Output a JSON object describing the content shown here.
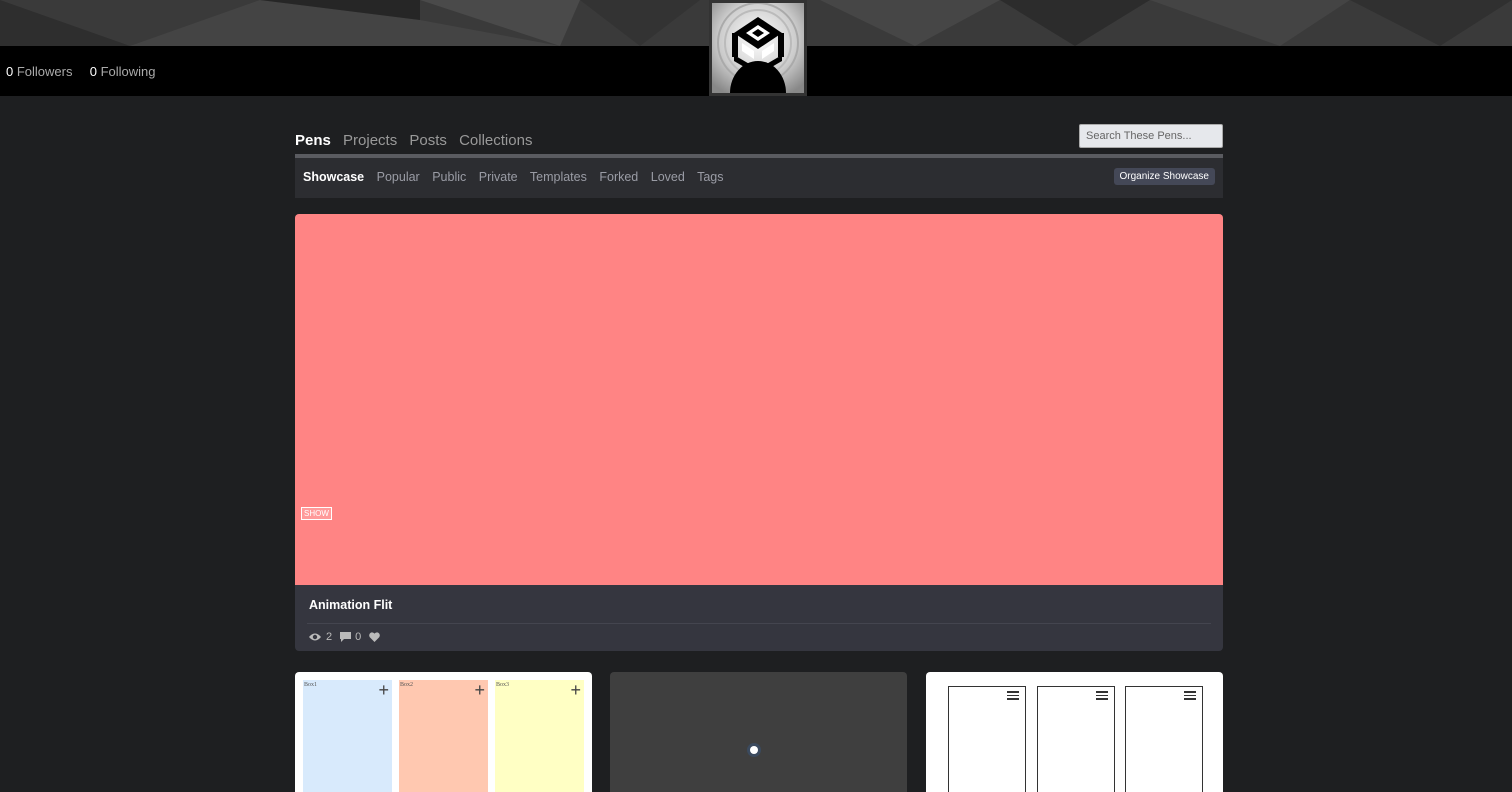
{
  "profile": {
    "followers_count": "0",
    "followers_label": "Followers",
    "following_count": "0",
    "following_label": "Following"
  },
  "tabs": {
    "main": [
      "Pens",
      "Projects",
      "Posts",
      "Collections"
    ],
    "active_main": "Pens",
    "sub": [
      "Showcase",
      "Popular",
      "Public",
      "Private",
      "Templates",
      "Forked",
      "Loved",
      "Tags"
    ],
    "active_sub": "Showcase"
  },
  "search": {
    "placeholder": "Search These Pens..."
  },
  "toolbar": {
    "organize_label": "Organize Showcase"
  },
  "showcase": {
    "preview_label": "SHOW",
    "title": "Animation Flit",
    "views": "2",
    "comments": "0",
    "preview_color": "#ff8484"
  },
  "grid": {
    "card1_boxes": [
      {
        "label": "Box1",
        "color": "#d8eafc"
      },
      {
        "label": "Box2",
        "color": "#ffc8b0"
      },
      {
        "label": "Box3",
        "color": "#ffffc4"
      }
    ]
  },
  "icons": [
    "eye-icon",
    "comment-icon",
    "heart-icon",
    "plus-icon",
    "menu-icon"
  ]
}
